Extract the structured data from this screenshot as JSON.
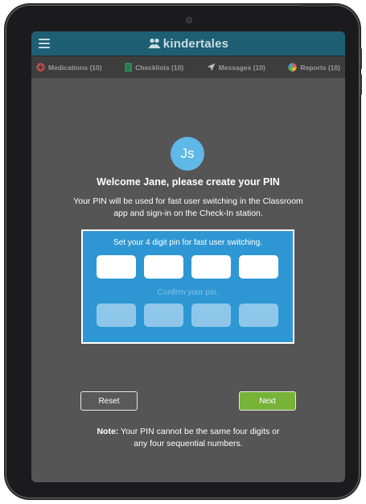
{
  "app": {
    "brand_name": "kindertales"
  },
  "tabs": [
    {
      "label": "Medications (10)",
      "icon": "medication-icon",
      "color": "#c84b4b"
    },
    {
      "label": "Checklists (10)",
      "icon": "checklist-icon",
      "color": "#2e8b57"
    },
    {
      "label": "Messages (10)",
      "icon": "paper-plane-icon",
      "color": "#bfbfbf"
    },
    {
      "label": "Reports (10)",
      "icon": "reports-pie-icon",
      "color": "#e05a4c"
    }
  ],
  "user": {
    "initials": "Js"
  },
  "welcome": {
    "title": "Welcome Jane, please create your PIN",
    "description": "Your PIN will be used for fast user switching in the Classroom app and sign-in on the Check-In station."
  },
  "pin": {
    "prompt": "Set your 4 digit pin for fast user switching.",
    "confirm_label": "Confirm your pin.",
    "digits": [
      "",
      "",
      "",
      ""
    ],
    "confirm_digits": [
      "",
      "",
      "",
      ""
    ]
  },
  "buttons": {
    "reset": "Reset",
    "next": "Next"
  },
  "note": {
    "label": "Note:",
    "text": "Your PIN cannot be the same four digits or any four sequential numbers."
  },
  "colors": {
    "header": "#1f5f73",
    "screen": "#555555",
    "pin_panel": "#2e97d3",
    "avatar": "#5fb8e6",
    "next_button": "#77b337"
  }
}
